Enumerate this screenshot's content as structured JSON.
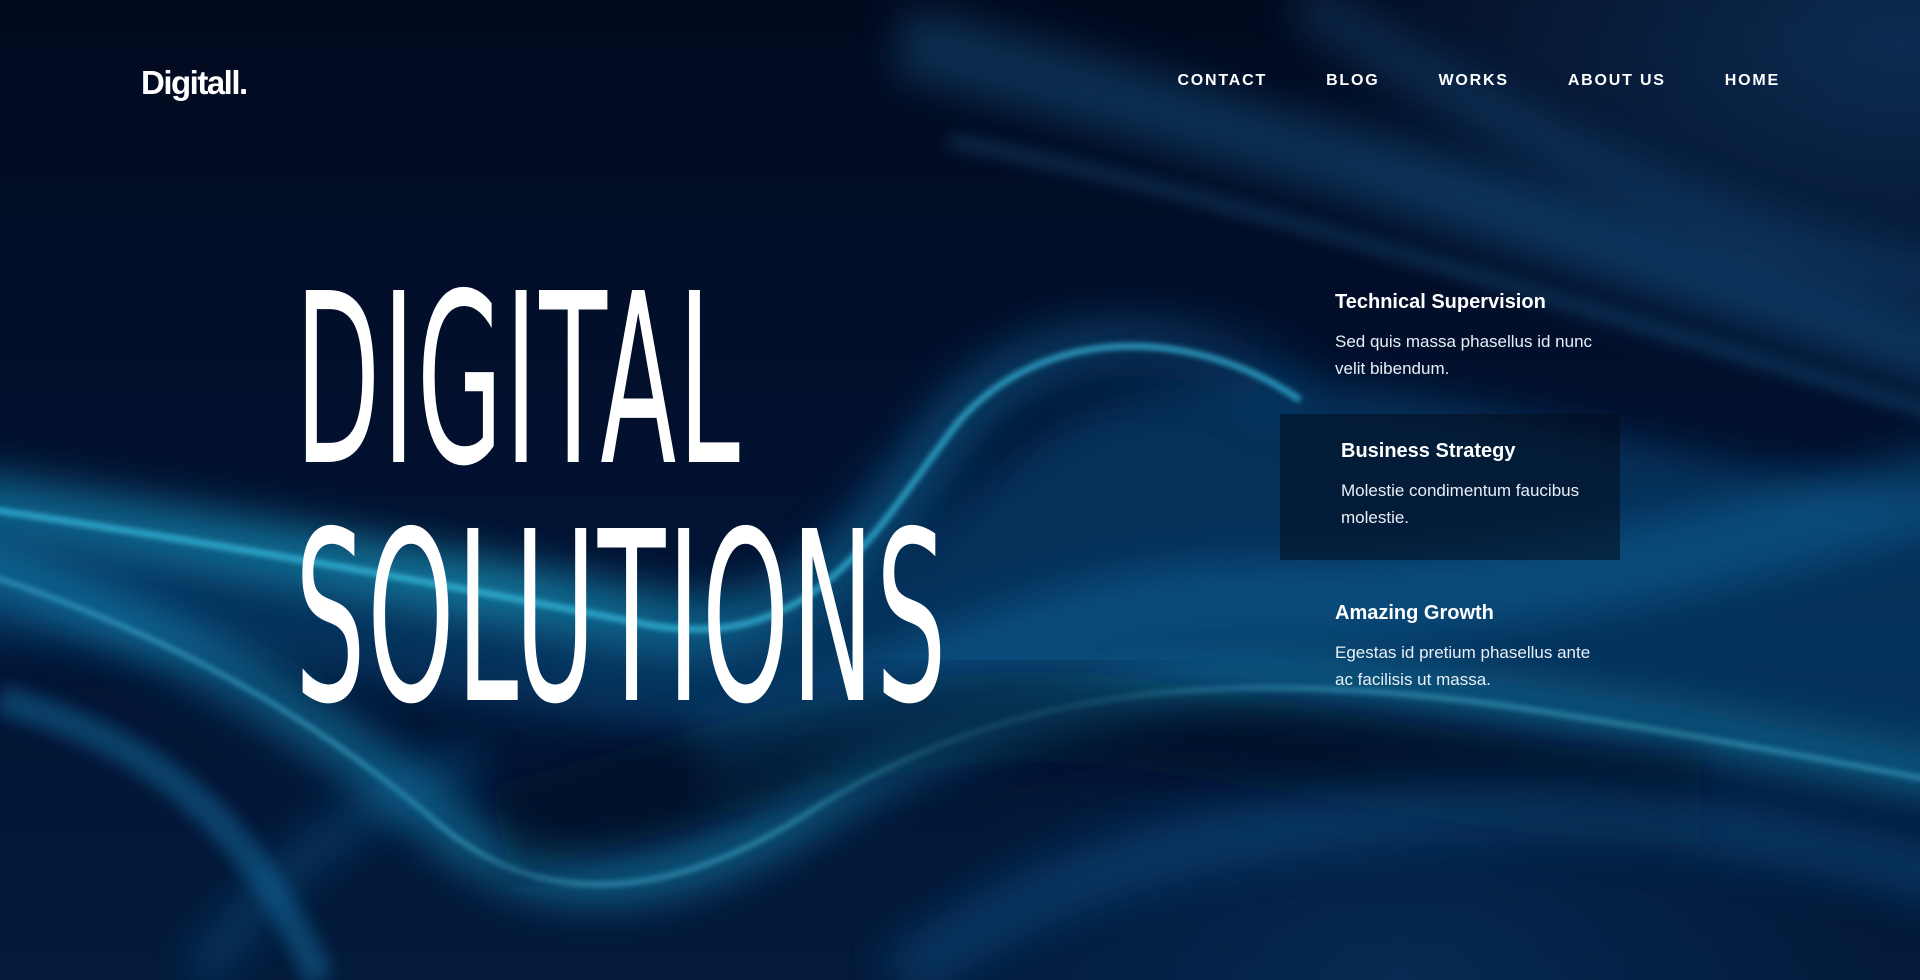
{
  "brand": {
    "logo": "Digitall."
  },
  "nav": {
    "items": [
      {
        "label": "CONTACT"
      },
      {
        "label": "BLOG"
      },
      {
        "label": "WORKS"
      },
      {
        "label": "ABOUT US"
      },
      {
        "label": "HOME"
      }
    ]
  },
  "hero": {
    "title_line1": "DIGITAL",
    "title_line2": "SOLUTIONS"
  },
  "features": [
    {
      "title": "Technical Supervision",
      "text": "Sed quis massa phasellus id nunc velit bibendum."
    },
    {
      "title": "Business Strategy",
      "text": "Molestie condimentum faucibus molestie."
    },
    {
      "title": "Amazing Growth",
      "text": "Egestas id pretium phasellus ante ac facilisis ut massa."
    }
  ],
  "colors": {
    "background": "#010a20",
    "accent": "#1fb8e0",
    "text": "#ffffff"
  }
}
